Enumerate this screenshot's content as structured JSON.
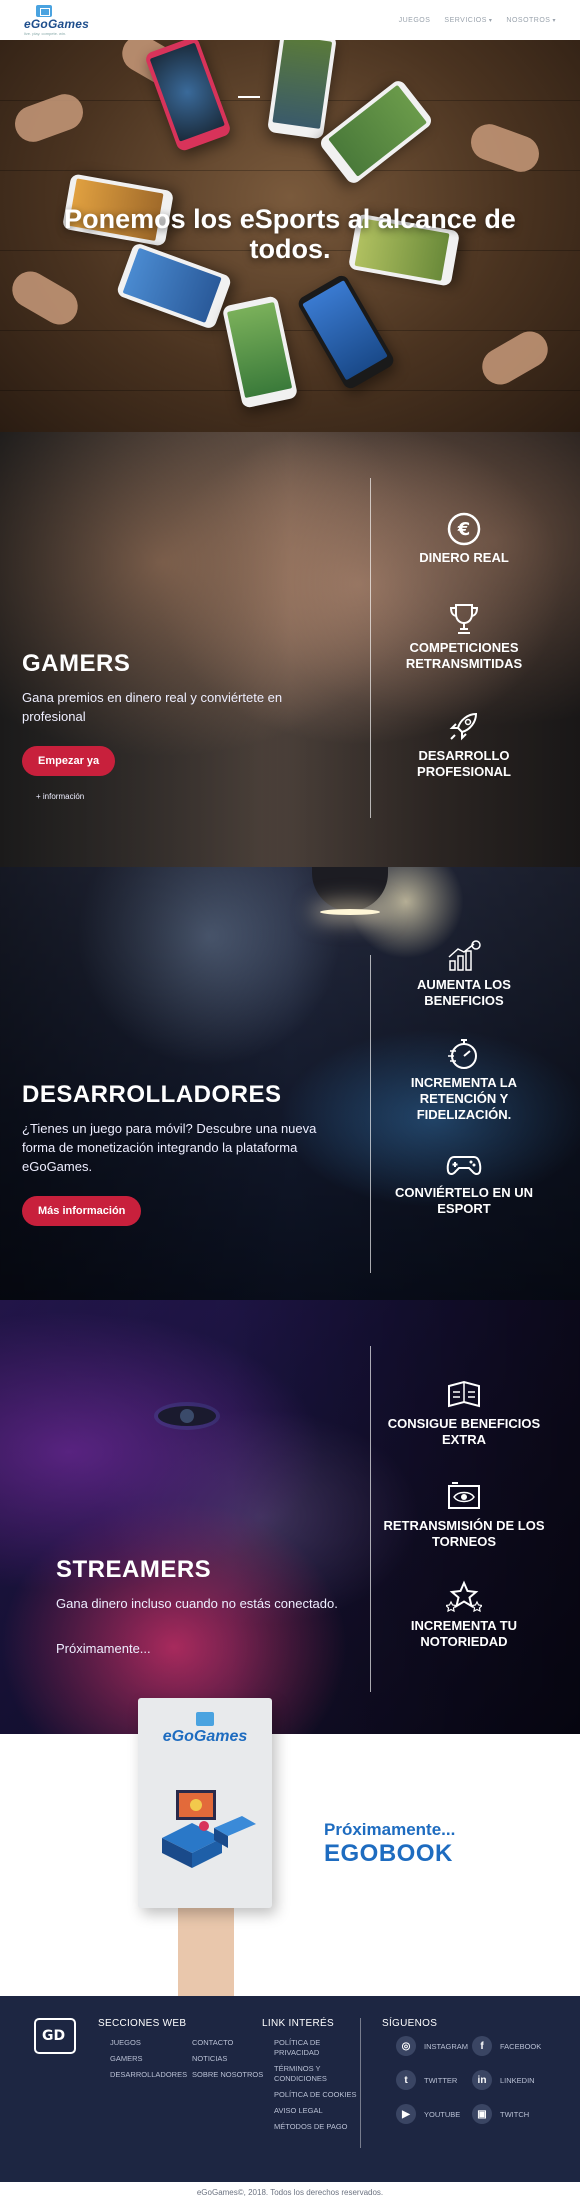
{
  "nav": {
    "logo_text": "eGoGames",
    "logo_sub": "live. play. compete. win.",
    "items": [
      {
        "label": "JUEGOS",
        "has_caret": false
      },
      {
        "label": "SERVICIOS",
        "has_caret": true
      },
      {
        "label": "NOSOTROS",
        "has_caret": true
      }
    ]
  },
  "hero": {
    "title": "Ponemos los eSports al alcance de todos."
  },
  "gamers": {
    "title": "GAMERS",
    "description": "Gana premios en dinero real y conviértete en profesional",
    "button": "Empezar ya",
    "more_link": "+ información",
    "features": [
      {
        "icon": "euro-icon",
        "label": "DINERO REAL"
      },
      {
        "icon": "trophy-icon",
        "label": "COMPETICIONES RETRANSMITIDAS"
      },
      {
        "icon": "rocket-icon",
        "label": "DESARROLLO PROFESIONAL"
      }
    ]
  },
  "devs": {
    "title": "DESARROLLADORES",
    "description": "¿Tienes un juego para móvil? Descubre una nueva forma de monetización integrando la plataforma eGoGames.",
    "button": "Más información",
    "features": [
      {
        "icon": "growth-chart-icon",
        "label": "AUMENTA LOS BENEFICIOS"
      },
      {
        "icon": "stopwatch-icon",
        "label": "INCREMENTA LA RETENCIÓN Y FIDELIZACIÓN."
      },
      {
        "icon": "gamepad-icon",
        "label": "CONVIÉRTELO EN UN ESPORT"
      }
    ]
  },
  "streamers": {
    "title": "STREAMERS",
    "description": "Gana dinero incluso cuando no estás conectado.",
    "soon": "Próximamente...",
    "features": [
      {
        "icon": "money-icon",
        "label": "CONSIGUE BENEFICIOS EXTRA"
      },
      {
        "icon": "broadcast-eye-icon",
        "label": "RETRANSMISIÓN DE LOS TORNEOS"
      },
      {
        "icon": "stars-icon",
        "label": "INCREMENTA TU NOTORIEDAD"
      }
    ]
  },
  "egobook": {
    "book_logo": "eGoGames",
    "line1": "Próximamente...",
    "line2": "EGOBOOK"
  },
  "footer": {
    "col1_title": "SECCIONES WEB",
    "col1_a": [
      "JUEGOS",
      "GAMERS",
      "DESARROLLADORES"
    ],
    "col1_b": [
      "CONTACTO",
      "NOTICIAS",
      "SOBRE NOSOTROS"
    ],
    "col2_title": "LINK INTERÉS",
    "col2": [
      "POLÍTICA DE PRIVACIDAD",
      "TÉRMINOS Y CONDICIONES",
      "POLÍTICA DE COOKIES",
      "AVISO LEGAL",
      "MÉTODOS DE PAGO"
    ],
    "col3_title": "SÍGUENOS",
    "social": [
      {
        "icon": "instagram-icon",
        "glyph": "◎",
        "label": "INSTAGRAM"
      },
      {
        "icon": "facebook-icon",
        "glyph": "f",
        "label": "FACEBOOK"
      },
      {
        "icon": "twitter-icon",
        "glyph": "t",
        "label": "TWITTER"
      },
      {
        "icon": "linkedin-icon",
        "glyph": "in",
        "label": "LINKEDIN"
      },
      {
        "icon": "youtube-icon",
        "glyph": "▶",
        "label": "YOUTUBE"
      },
      {
        "icon": "twitch-icon",
        "glyph": "▣",
        "label": "TWITCH"
      }
    ]
  },
  "copyright": "eGoGames©, 2018. Todos los derechos reservados.",
  "colors": {
    "accent": "#c8203c",
    "brand_blue": "#1e6cc0",
    "footer_bg": "#1d2642"
  }
}
